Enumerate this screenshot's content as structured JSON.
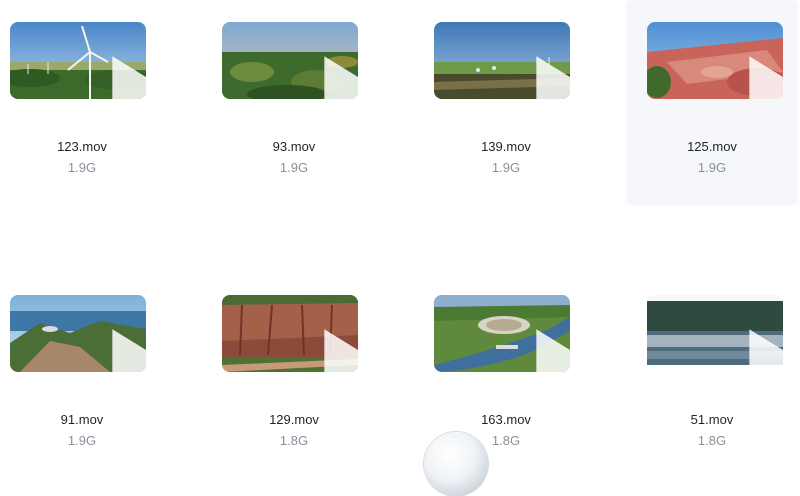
{
  "files": [
    {
      "name": "123.mov",
      "size": "1.9G",
      "scene": "wind-turbines"
    },
    {
      "name": "93.mov",
      "size": "1.9G",
      "scene": "forest"
    },
    {
      "name": "139.mov",
      "size": "1.9G",
      "scene": "farmland"
    },
    {
      "name": "125.mov",
      "size": "1.9G",
      "scene": "red-quarry",
      "selected": true
    },
    {
      "name": "91.mov",
      "size": "1.9G",
      "scene": "coastal-mountain"
    },
    {
      "name": "129.mov",
      "size": "1.8G",
      "scene": "red-cliffs"
    },
    {
      "name": "163.mov",
      "size": "1.8G",
      "scene": "river-town"
    },
    {
      "name": "51.mov",
      "size": "1.8G",
      "scene": "misty-lake"
    }
  ],
  "icons": {
    "play": "play-icon",
    "bubble": "floating-assistant-bubble"
  },
  "colors": {
    "selected_bg": "#f5f7fa",
    "name_text": "#1f2329",
    "size_text": "#8a9099"
  }
}
